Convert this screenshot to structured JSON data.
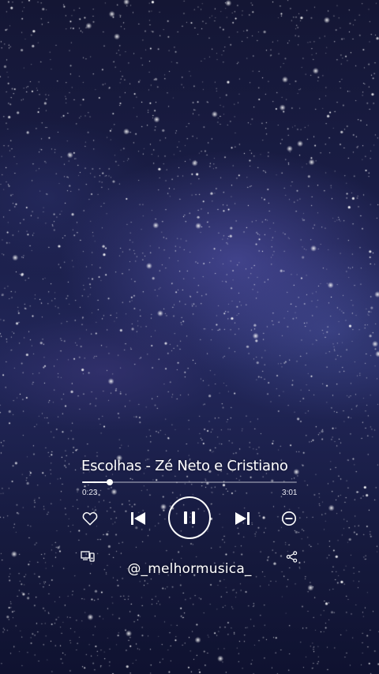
{
  "player": {
    "track_title": "Escolhas - Zé Neto e Cristiano",
    "elapsed": "0:23",
    "duration": "3:01",
    "progress": 0.127
  },
  "watermark": {
    "handle": "@_melhormusica_"
  },
  "icons": {
    "like": "heart-icon",
    "previous": "skip-previous-icon",
    "play_pause": "pause-icon",
    "next": "skip-next-icon",
    "remove": "minus-circle-icon",
    "devices": "devices-icon",
    "share": "share-icon"
  },
  "colors": {
    "text": "#ffffff",
    "sky": "#1b1f4a"
  }
}
